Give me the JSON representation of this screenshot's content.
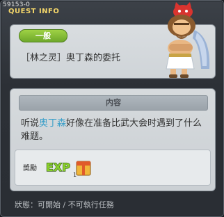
{
  "window": {
    "quest_id": "59153-0",
    "title": "QUEST INFO"
  },
  "header": {
    "category_badge": "一般",
    "quest_name": "［林之灵］奥丁森的委托"
  },
  "content": {
    "section_title": "内容",
    "description_pre": "听说",
    "description_highlight": "奥丁森",
    "description_post": "好像在准备比武大会时遇到了什么难题。",
    "highlight_color": "#3a9fc9"
  },
  "reward": {
    "label": "獎勵",
    "exp_text": "EXP",
    "item_count": "1",
    "item_icon": "quest-item-box-icon"
  },
  "status": {
    "text": "狀態：可開始 / 不可執行任務"
  },
  "colors": {
    "title": "#f5d76a",
    "badge_green": "#7cb832",
    "window_bg": "#2c3036"
  }
}
